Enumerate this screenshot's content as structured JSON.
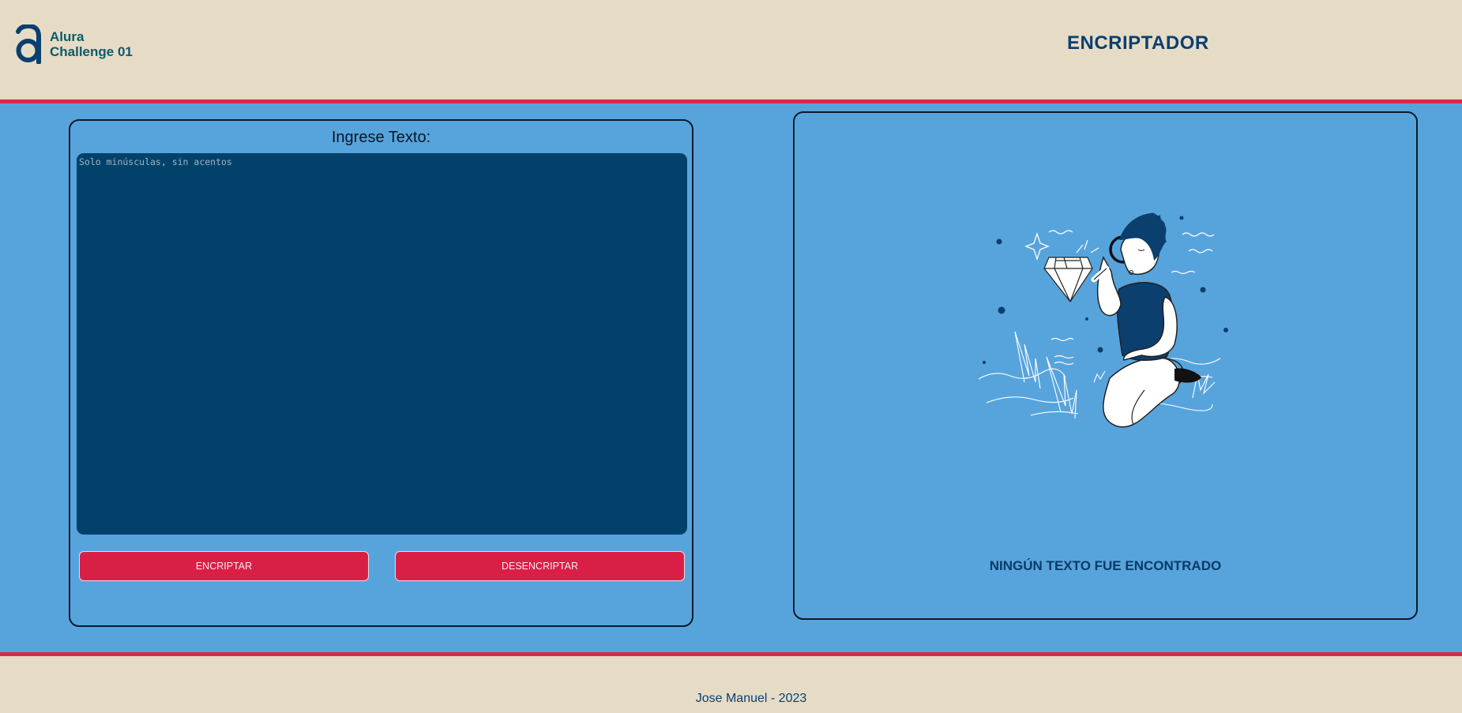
{
  "header": {
    "logo_line1": "Alura",
    "logo_line2": "Challenge 01",
    "title": "ENCRIPTADOR"
  },
  "input": {
    "label": "Ingrese Texto:",
    "placeholder": "Solo minúsculas, sin acentos",
    "value": ""
  },
  "buttons": {
    "encrypt": "ENCRIPTAR",
    "decrypt": "DESENCRIPTAR"
  },
  "output": {
    "illustration": "person-with-magnifying-glass-and-diamond",
    "message": "NINGÚN TEXTO FUE ENCONTRADO"
  },
  "footer": {
    "text": "Jose Manuel - 2023"
  },
  "colors": {
    "header_bg": "#e6dcc6",
    "main_bg": "#57a4dd",
    "accent_rule": "#d42a4a",
    "textarea_bg": "#02426a",
    "button_bg": "#da1f47",
    "title_text": "#0a3f6e"
  }
}
